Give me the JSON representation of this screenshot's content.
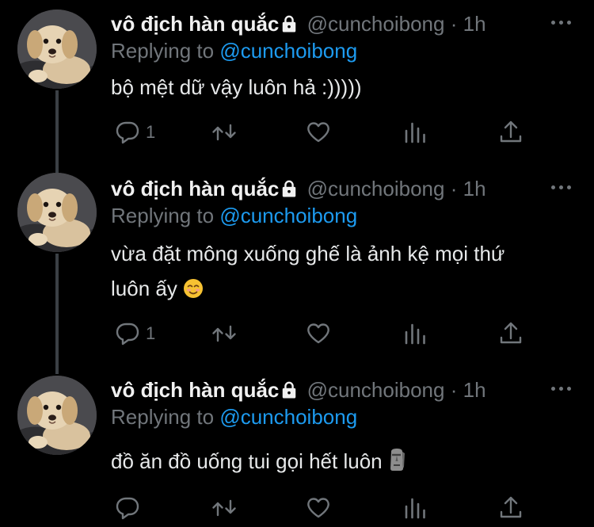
{
  "tweets": [
    {
      "author": "vô địch hàn quắc",
      "handle": "@cuncho­ibong",
      "time": "1h",
      "replying_label": "Replying to",
      "replying_to": "@cunchoibong",
      "text": "bộ mệt dữ vậy luôn hả :)))))",
      "reply_count": "1"
    },
    {
      "author": "vô địch hàn quắc",
      "handle": "@cunchoibong",
      "time": "1h",
      "replying_label": "Replying to",
      "replying_to": "@cunchoibong",
      "text_line1": "vừa đặt mông xuống ghế là ảnh kệ mọi thứ",
      "text_line2": "luôn ấy",
      "reply_count": "1"
    },
    {
      "author": "vô địch hàn quắc",
      "handle": "@cunchoibong",
      "time": "1h",
      "replying_label": "Replying to",
      "replying_to": "@cunchoibong",
      "text": "đồ ăn đồ uống tui gọi hết luôn",
      "reply_count": ""
    }
  ],
  "separator": "·",
  "colors": {
    "background": "#000000",
    "muted": "#71767b",
    "accent": "#1d9bf0",
    "thread_line": "#3b4045"
  },
  "icons": [
    "lock-icon",
    "more-icon",
    "reply-icon",
    "retweet-icon",
    "like-icon",
    "analytics-icon",
    "share-icon",
    "smiling-face-emoji",
    "moai-emoji"
  ]
}
